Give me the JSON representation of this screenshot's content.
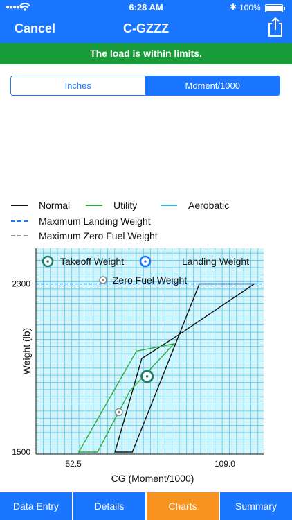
{
  "status": {
    "time": "6:28 AM",
    "battery": "100%",
    "battery_level": 1.0
  },
  "nav": {
    "cancel": "Cancel",
    "title": "C-GZZZ"
  },
  "banner": {
    "text": "The load is within limits.",
    "color": "#1a9c3a"
  },
  "segment": {
    "options": [
      "Inches",
      "Moment/1000"
    ],
    "selected": "Moment/1000"
  },
  "legend": {
    "normal": "Normal",
    "utility": "Utility",
    "aerobatic": "Aerobatic",
    "max_landing": "Maximum Landing Weight",
    "max_zero_fuel": "Maximum Zero Fuel Weight"
  },
  "chart_data": {
    "type": "scatter",
    "xlabel": "CG (Moment/1000)",
    "ylabel": "Weight (lb)",
    "x_ticks": [
      "52.5",
      "109.0"
    ],
    "y_ticks": [
      "1500",
      "2300"
    ],
    "xlim": [
      38.5,
      123.5
    ],
    "ylim": [
      1490,
      2470
    ],
    "grid": true,
    "series": [
      {
        "name": "Normal",
        "color": "#111111",
        "points": [
          [
            74.5,
            1500
          ],
          [
            99.5,
            2300
          ],
          [
            120.0,
            2300
          ],
          [
            92.0,
            2060
          ],
          [
            78.0,
            1945
          ],
          [
            68.0,
            1500
          ]
        ]
      },
      {
        "name": "Utility",
        "color": "#2eaa3c",
        "points": [
          [
            54.5,
            1500
          ],
          [
            76.0,
            1980
          ],
          [
            90.0,
            2015
          ],
          [
            73.5,
            1790
          ],
          [
            61.5,
            1500
          ]
        ]
      },
      {
        "name": "Maximum Landing Weight",
        "color": "#1a75ff",
        "y": 2300
      }
    ],
    "annotations": [
      {
        "label": "Takeoff Weight",
        "x": 80.0,
        "y": 1860,
        "color": "#1b7f6b"
      },
      {
        "label": "Landing Weight",
        "color": "#1a75ff"
      },
      {
        "label": "Zero Fuel Weight",
        "x": 69.5,
        "y": 1690,
        "color": "#888888"
      }
    ]
  },
  "tabs": [
    {
      "label": "Data Entry"
    },
    {
      "label": "Details"
    },
    {
      "label": "Charts",
      "active": true
    },
    {
      "label": "Summary"
    }
  ],
  "colors": {
    "accent": "#1a75ff",
    "active_tab": "#f7931e",
    "grid": "#52c8e8",
    "plot_bg": "#d4f4fa"
  }
}
